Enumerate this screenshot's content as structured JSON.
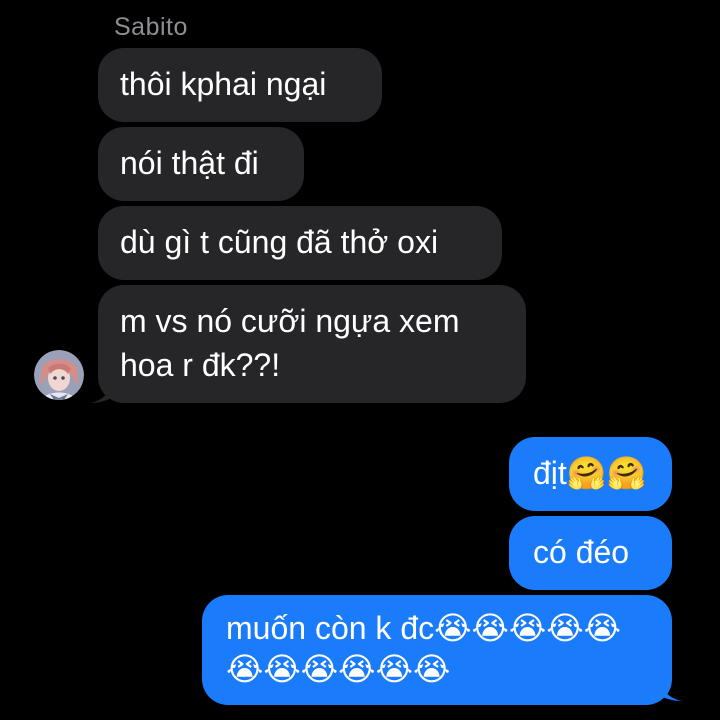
{
  "conversation": {
    "sender_name": "Sabito",
    "incoming": [
      {
        "text": "thôi kphai ngại"
      },
      {
        "text": "nói thật đi"
      },
      {
        "text": "dù gì t cũng đã thở oxi"
      },
      {
        "line1": "m vs nó cưỡi ngựa xem",
        "line2": "hoa r đk??!"
      }
    ],
    "outgoing": [
      {
        "text": "địt🤗🤗"
      },
      {
        "text": "có đéo"
      },
      {
        "line1": "muốn còn k đc😭😭😭😭😭",
        "line2": "😭😭😭😭😭😭"
      }
    ]
  },
  "colors": {
    "background": "#000000",
    "incoming_bubble": "#262629",
    "outgoing_bubble": "#1a7cfa",
    "sender_name": "#8e8e93"
  },
  "avatar": {
    "icon": "anime-character-avatar"
  }
}
